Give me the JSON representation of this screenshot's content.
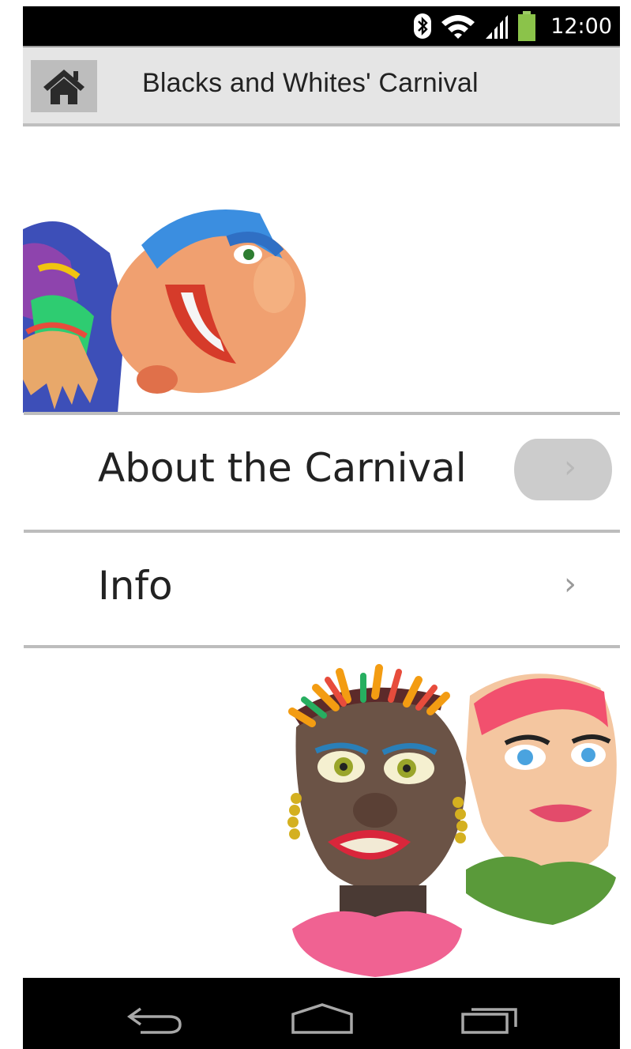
{
  "status_bar": {
    "time": "12:00",
    "icons": [
      "bluetooth-icon",
      "wifi-icon",
      "signal-icon",
      "battery-icon"
    ],
    "battery_color": "#8bc34a"
  },
  "action_bar": {
    "title": "Blacks and Whites' Carnival",
    "home_icon": "home-icon"
  },
  "menu": {
    "items": [
      {
        "label": "About the Carnival",
        "icon": "chevron-right-icon",
        "pressed": true
      },
      {
        "label": "Info",
        "icon": "chevron-right-icon",
        "pressed": false
      }
    ],
    "chevron_glyph": "›"
  },
  "images": {
    "top": "carnival-figure-image",
    "bottom": "carnival-masks-image"
  },
  "nav_bar": {
    "buttons": [
      "back-icon",
      "home-nav-icon",
      "recent-apps-icon"
    ]
  }
}
